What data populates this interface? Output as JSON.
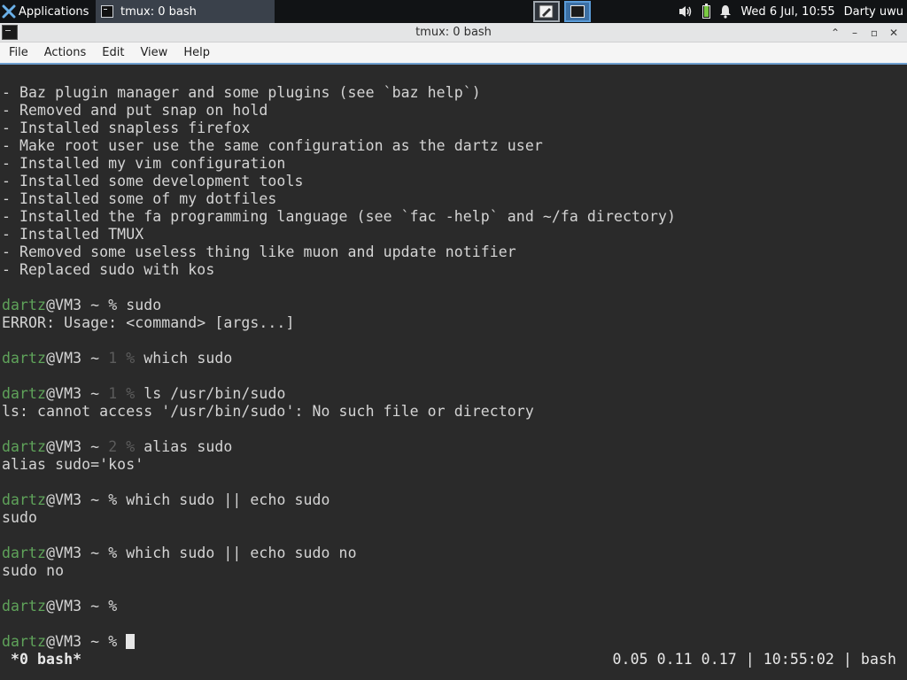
{
  "panel": {
    "applications_label": "Applications",
    "task_title": "tmux: 0 bash",
    "volume_icon": "volume-icon",
    "battery_level": 0.85,
    "notifications_icon": "bell-icon",
    "clock": "Wed  6 Jul, 10:55",
    "user": "Darty uwu"
  },
  "window": {
    "title": "tmux: 0 bash",
    "buttons": {
      "up": "⌃",
      "minimize": "–",
      "maximize": "▫",
      "close": "✕"
    }
  },
  "menubar": {
    "items": [
      "File",
      "Actions",
      "Edit",
      "View",
      "Help"
    ]
  },
  "terminal": {
    "lines": [
      {
        "type": "text",
        "text": "- Baz plugin manager and some plugins (see `baz help`)"
      },
      {
        "type": "text",
        "text": "- Removed and put snap on hold"
      },
      {
        "type": "text",
        "text": "- Installed snapless firefox"
      },
      {
        "type": "text",
        "text": "- Make root user use the same configuration as the dartz user"
      },
      {
        "type": "text",
        "text": "- Installed my vim configuration"
      },
      {
        "type": "text",
        "text": "- Installed some development tools"
      },
      {
        "type": "text",
        "text": "- Installed some of my dotfiles"
      },
      {
        "type": "text",
        "text": "- Installed the fa programming language (see `fac -help` and ~/fa directory)"
      },
      {
        "type": "text",
        "text": "- Installed TMUX"
      },
      {
        "type": "text",
        "text": "- Removed some useless thing like muon and update notifier"
      },
      {
        "type": "text",
        "text": "- Replaced sudo with kos"
      },
      {
        "type": "blank"
      },
      {
        "type": "prompt",
        "user": "dartz",
        "host": "@VM3 ~ ",
        "code": "",
        "symbol": "%",
        "cmd": " sudo"
      },
      {
        "type": "text",
        "text": "ERROR: Usage: <command> [args...]"
      },
      {
        "type": "blank"
      },
      {
        "type": "prompt",
        "user": "dartz",
        "host": "@VM3 ~ ",
        "code": "1 ",
        "symbol": "%",
        "cmd": " which sudo"
      },
      {
        "type": "blank"
      },
      {
        "type": "prompt",
        "user": "dartz",
        "host": "@VM3 ~ ",
        "code": "1 ",
        "symbol": "%",
        "cmd": " ls /usr/bin/sudo"
      },
      {
        "type": "text",
        "text": "ls: cannot access '/usr/bin/sudo': No such file or directory"
      },
      {
        "type": "blank"
      },
      {
        "type": "prompt",
        "user": "dartz",
        "host": "@VM3 ~ ",
        "code": "2 ",
        "symbol": "%",
        "cmd": " alias sudo"
      },
      {
        "type": "text",
        "text": "alias sudo='kos'"
      },
      {
        "type": "blank"
      },
      {
        "type": "prompt",
        "user": "dartz",
        "host": "@VM3 ~ ",
        "code": "",
        "symbol": "%",
        "cmd": " which sudo || echo sudo"
      },
      {
        "type": "text",
        "text": "sudo"
      },
      {
        "type": "blank"
      },
      {
        "type": "prompt",
        "user": "dartz",
        "host": "@VM3 ~ ",
        "code": "",
        "symbol": "%",
        "cmd": " which sudo || echo sudo no"
      },
      {
        "type": "text",
        "text": "sudo no"
      },
      {
        "type": "blank"
      },
      {
        "type": "prompt",
        "user": "dartz",
        "host": "@VM3 ~ ",
        "code": "",
        "symbol": "%",
        "cmd": ""
      },
      {
        "type": "blank"
      },
      {
        "type": "prompt",
        "user": "dartz",
        "host": "@VM3 ~ ",
        "code": "",
        "symbol": "%",
        "cmd": " ",
        "cursor": true
      }
    ]
  },
  "tmux_status": {
    "left": "*0 bash*",
    "right": "0.05 0.11 0.17 | 10:55:02 | bash"
  },
  "colors": {
    "user": "#5fa35a",
    "terminal_bg": "#2a2a2a",
    "terminal_fg": "#d4d4d4",
    "dim": "#5c5c5c"
  }
}
